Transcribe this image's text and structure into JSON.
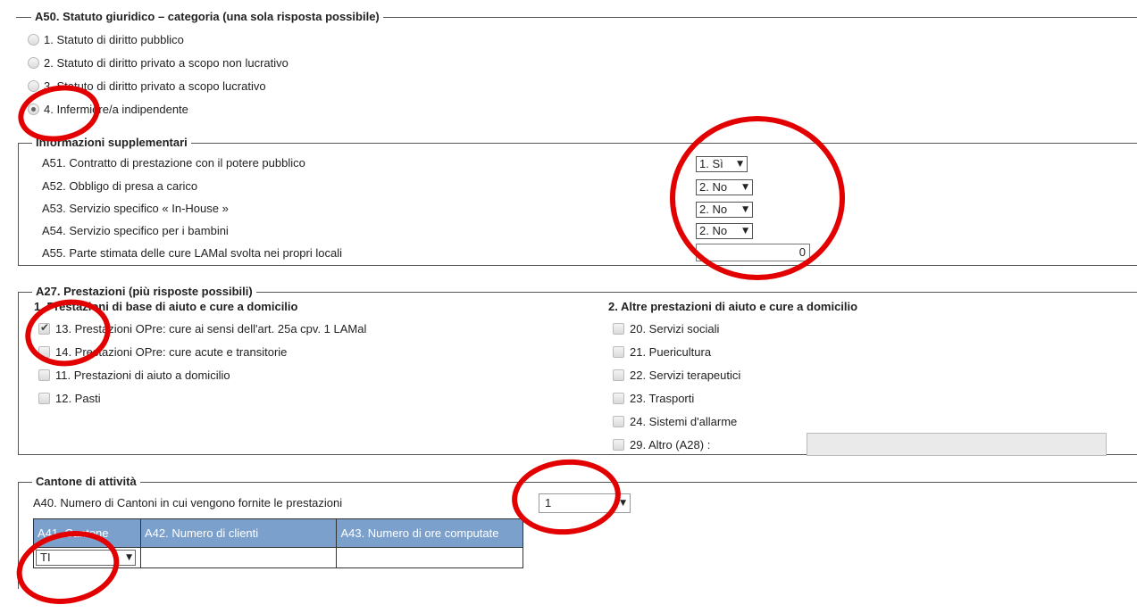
{
  "a50": {
    "legend": "A50. Statuto giuridico – categoria (una sola risposta possibile)",
    "options": [
      {
        "label": "1. Statuto di diritto pubblico",
        "checked": false
      },
      {
        "label": "2. Statuto di diritto privato a scopo non lucrativo",
        "checked": false
      },
      {
        "label": "3. Statuto di diritto privato a scopo lucrativo",
        "checked": false
      },
      {
        "label": "4. Infermiere/a indipendente",
        "checked": true
      }
    ]
  },
  "info": {
    "legend": "Informazioni supplementari",
    "rows": [
      {
        "label": "A51. Contratto di prestazione con il potere pubblico",
        "value": "1. Sì"
      },
      {
        "label": "A52. Obbligo di presa a carico",
        "value": "2. No"
      },
      {
        "label": "A53. Servizio specifico « In-House »",
        "value": "2. No"
      },
      {
        "label": "A54. Servizio specifico per i bambini",
        "value": "2. No"
      }
    ],
    "a55_label": "A55. Parte stimata delle cure LAMal svolta nei propri locali",
    "a55_value": "0"
  },
  "a27": {
    "legend": "A27. Prestazioni (più risposte possibili)",
    "col1_title": "1. Prestazioni di base di aiuto e cure a domicilio",
    "col1": [
      {
        "label": "13. Prestazioni OPre: cure ai sensi dell'art. 25a cpv. 1 LAMal",
        "checked": true
      },
      {
        "label": "14. Prestazioni OPre: cure acute e transitorie",
        "checked": false
      },
      {
        "label": "11. Prestazioni di aiuto a domicilio",
        "checked": false
      },
      {
        "label": "12. Pasti",
        "checked": false
      }
    ],
    "col2_title": "2. Altre prestazioni di aiuto e cure a domicilio",
    "col2": [
      {
        "label": "20. Servizi sociali",
        "checked": false
      },
      {
        "label": "21. Puericultura",
        "checked": false
      },
      {
        "label": "22. Servizi terapeutici",
        "checked": false
      },
      {
        "label": "23. Trasporti",
        "checked": false
      },
      {
        "label": "24. Sistemi d'allarme",
        "checked": false
      },
      {
        "label": "29. Altro (A28) :",
        "checked": false
      }
    ],
    "other_text": ""
  },
  "cantone": {
    "legend": "Cantone di attività",
    "a40_label": "A40. Numero di Cantoni in cui vengono fornite le prestazioni",
    "a40_value": "1",
    "table_headers": [
      "A41. Cantone",
      "A42. Numero di clienti",
      "A43. Numero di ore computate"
    ],
    "row": {
      "cantone": "TI",
      "clienti": "",
      "ore": ""
    }
  },
  "icons": {
    "select_arrow": "▼"
  },
  "colors": {
    "table_header": "#7ba0cc",
    "annotation": "#e30000"
  }
}
